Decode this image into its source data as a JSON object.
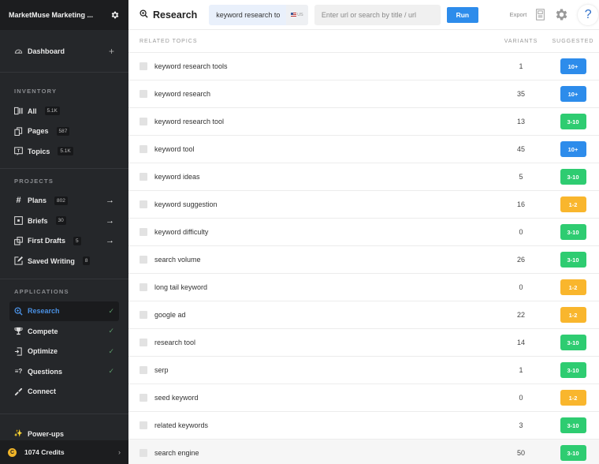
{
  "sidebar": {
    "org_name": "MarketMuse Marketing ...",
    "dashboard_label": "Dashboard",
    "sections": {
      "inventory": "INVENTORY",
      "projects": "PROJECTS",
      "applications": "APPLICATIONS"
    },
    "inventory": [
      {
        "label": "All",
        "count": "5.1K",
        "icon": "columns-icon"
      },
      {
        "label": "Pages",
        "count": "587",
        "icon": "pages-icon"
      },
      {
        "label": "Topics",
        "count": "5.1K",
        "icon": "topics-icon"
      }
    ],
    "projects": [
      {
        "label": "Plans",
        "count": "802",
        "icon": "hash-icon",
        "arrow": "→"
      },
      {
        "label": "Briefs",
        "count": "30",
        "icon": "brief-icon",
        "arrow": "→"
      },
      {
        "label": "First Drafts",
        "count": "5",
        "icon": "drafts-icon",
        "arrow": "→"
      },
      {
        "label": "Saved Writing",
        "count": "8",
        "icon": "edit-icon"
      }
    ],
    "applications": [
      {
        "label": "Research",
        "icon": "search-icon",
        "check": "✓",
        "active": true
      },
      {
        "label": "Compete",
        "icon": "trophy-icon",
        "check": "✓"
      },
      {
        "label": "Optimize",
        "icon": "optimize-icon",
        "check": "✓"
      },
      {
        "label": "Questions",
        "icon": "questions-icon",
        "check": "✓"
      },
      {
        "label": "Connect",
        "icon": "link-icon"
      }
    ],
    "powerups_label": "Power-ups",
    "credits_label": "1074 Credits",
    "coin_glyph": "C"
  },
  "topbar": {
    "title": "Research",
    "keyword_value": "keyword research to",
    "country": "US",
    "url_placeholder": "Enter url or search by title / url",
    "run_label": "Run",
    "export_label": "Export",
    "help_glyph": "?"
  },
  "table": {
    "headers": {
      "topic": "RELATED TOPICS",
      "variants": "VARIANTS",
      "suggested": "SUGGESTED"
    },
    "colors": {
      "10+": "#2d8ceb",
      "3-10": "#2ecc71",
      "1-2": "#f9b62d"
    },
    "rows": [
      {
        "topic": "keyword research tools",
        "variants": "1",
        "suggested": "10+"
      },
      {
        "topic": "keyword research",
        "variants": "35",
        "suggested": "10+"
      },
      {
        "topic": "keyword research tool",
        "variants": "13",
        "suggested": "3-10"
      },
      {
        "topic": "keyword tool",
        "variants": "45",
        "suggested": "10+"
      },
      {
        "topic": "keyword ideas",
        "variants": "5",
        "suggested": "3-10"
      },
      {
        "topic": "keyword suggestion",
        "variants": "16",
        "suggested": "1-2"
      },
      {
        "topic": "keyword difficulty",
        "variants": "0",
        "suggested": "3-10"
      },
      {
        "topic": "search volume",
        "variants": "26",
        "suggested": "3-10"
      },
      {
        "topic": "long tail keyword",
        "variants": "0",
        "suggested": "1-2"
      },
      {
        "topic": "google ad",
        "variants": "22",
        "suggested": "1-2"
      },
      {
        "topic": "research tool",
        "variants": "14",
        "suggested": "3-10"
      },
      {
        "topic": "serp",
        "variants": "1",
        "suggested": "3-10"
      },
      {
        "topic": "seed keyword",
        "variants": "0",
        "suggested": "1-2"
      },
      {
        "topic": "related keywords",
        "variants": "3",
        "suggested": "3-10"
      },
      {
        "topic": "search engine",
        "variants": "50",
        "suggested": "3-10",
        "hover": true
      }
    ]
  }
}
